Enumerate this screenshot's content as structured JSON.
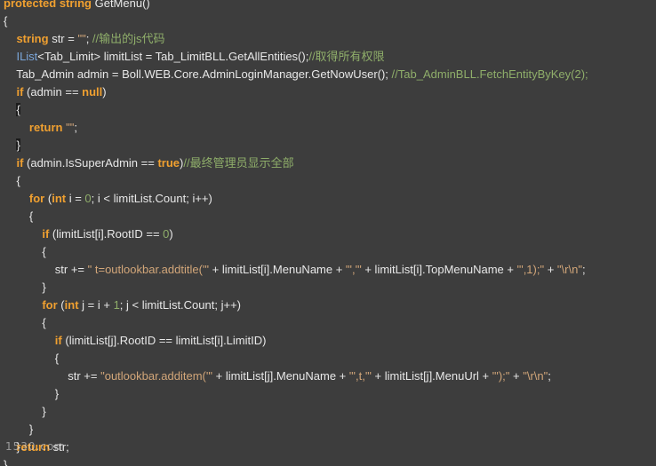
{
  "colors": {
    "background": "#3d3d3d",
    "keyword": "#f0a030",
    "interface": "#7aa6da",
    "string": "#d2a679",
    "comment": "#8fae6a",
    "text": "#e8e8e8"
  },
  "code": {
    "l01": {
      "a": "protected",
      "b": " ",
      "c": "string",
      "d": " GetMenu()"
    },
    "l02": {
      "a": "{"
    },
    "l03": {
      "a": "    ",
      "b": "string",
      "c": " str = ",
      "d": "\"\"",
      "e": "; ",
      "f": "//输出的js代码"
    },
    "l04": {
      "a": "    ",
      "b": "IList",
      "c": "<Tab_Limit> limitList = Tab_LimitBLL.GetAllEntities();",
      "d": "//取得所有权限"
    },
    "l05": {
      "a": "    Tab_Admin admin = Boll.WEB.Core.AdminLoginManager.GetNowUser(); ",
      "b": "//Tab_AdminBLL.FetchEntityByKey(2);"
    },
    "l06": {
      "a": "    ",
      "b": "if",
      "c": " (admin == ",
      "d": "null",
      "e": ")"
    },
    "l07": {
      "a": "    ",
      "b": "{"
    },
    "l08": {
      "a": "        ",
      "b": "return",
      "c": " ",
      "d": "\"\"",
      "e": ";"
    },
    "l09": {
      "a": "    ",
      "b": "}"
    },
    "l10": {
      "a": "    ",
      "b": "if",
      "c": " (admin.IsSuperAdmin == ",
      "d": "true",
      "e": ")",
      "f": "//最终管理员显示全部"
    },
    "l11": {
      "a": "    {"
    },
    "l12": {
      "a": "        ",
      "b": "for",
      "c": " (",
      "d": "int",
      "e": " i = ",
      "f": "0",
      "g": "; i < limitList.Count; i++)"
    },
    "l13": {
      "a": "        {"
    },
    "l14": {
      "a": "            ",
      "b": "if",
      "c": " (limitList[i].RootID == ",
      "d": "0",
      "e": ")"
    },
    "l15": {
      "a": "            {"
    },
    "l16": {
      "a": "                str += ",
      "b": "\" t=outlookbar.addtitle('\"",
      "c": " + limitList[i].MenuName + ",
      "d": "\"','\"",
      "e": " + limitList[i].TopMenuName + ",
      "f": "\"',1);\"",
      "g": " + ",
      "h": "\"\\r\\n\"",
      "i": ";"
    },
    "l17": {
      "a": "            }"
    },
    "l18": {
      "a": "            ",
      "b": "for",
      "c": " (",
      "d": "int",
      "e": " j = i + ",
      "f": "1",
      "g": "; j < limitList.Count; j++)"
    },
    "l19": {
      "a": "            {"
    },
    "l20": {
      "a": "                ",
      "b": "if",
      "c": " (limitList[j].RootID == limitList[i].LimitID)"
    },
    "l21": {
      "a": "                {"
    },
    "l22": {
      "a": "                    str += ",
      "b": "\"outlookbar.additem('\"",
      "c": " + limitList[j].MenuName + ",
      "d": "\"',t,'\"",
      "e": " + limitList[j].MenuUrl + ",
      "f": "\"');\"",
      "g": " + ",
      "h": "\"\\r\\n\"",
      "i": ";"
    },
    "l23": {
      "a": "                }"
    },
    "l24": {
      "a": "            }"
    },
    "l25": {
      "a": "        }"
    },
    "l26": {
      "a": "    }"
    },
    "l27": {
      "a": "    ",
      "b": "return",
      "c": " str;"
    },
    "l28": {
      "a": "}"
    }
  },
  "watermark": "1530.com"
}
